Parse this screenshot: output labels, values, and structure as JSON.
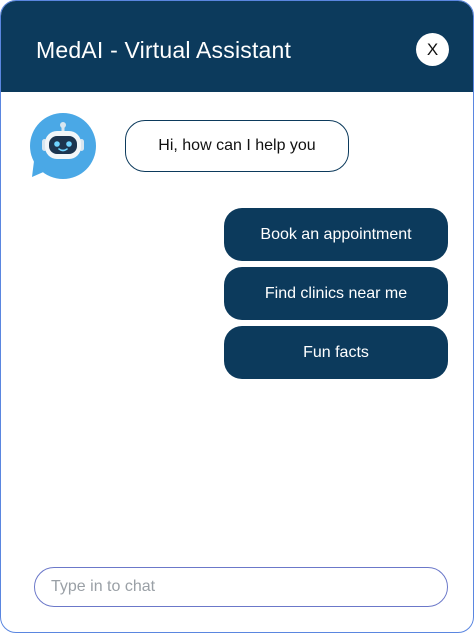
{
  "header": {
    "title": "MedAI - Virtual Assistant",
    "close_label": "X"
  },
  "colors": {
    "primary": "#0c3a5c",
    "avatar_bg": "#4aa8e6",
    "window_border": "#5a86e0"
  },
  "messages": {
    "bot_greeting": "Hi, how can I help you",
    "avatar_icon": "robot-icon"
  },
  "options": [
    {
      "label": "Book an appointment"
    },
    {
      "label": "Find clinics near me"
    },
    {
      "label": "Fun facts"
    }
  ],
  "input": {
    "placeholder": "Type in to chat",
    "value": ""
  }
}
